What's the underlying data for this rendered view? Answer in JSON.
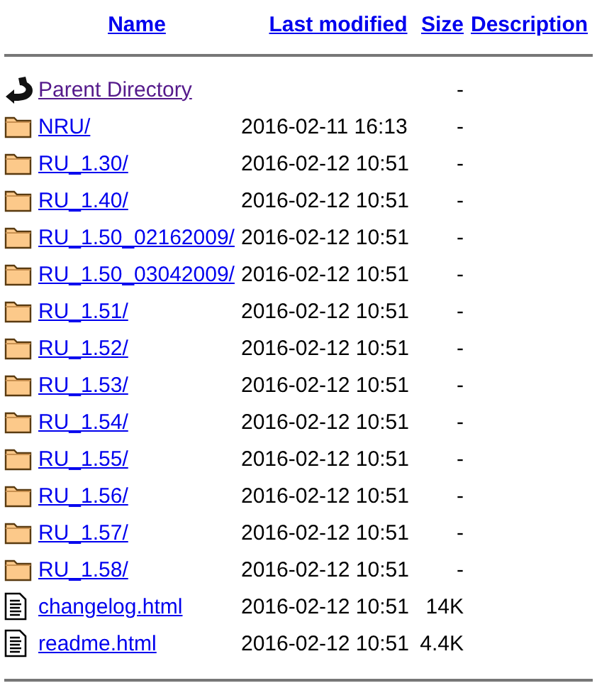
{
  "columns": [
    "Name",
    "Last modified",
    "Size",
    "Description"
  ],
  "entries": [
    {
      "kind": "parent",
      "name": "Parent Directory",
      "visited": true,
      "size": "-"
    },
    {
      "kind": "folder",
      "name": "NRU/",
      "visited": false,
      "modified": "2016-02-11 16:13",
      "size": "-"
    },
    {
      "kind": "folder",
      "name": "RU_1.30/",
      "visited": false,
      "modified": "2016-02-12 10:51",
      "size": "-"
    },
    {
      "kind": "folder",
      "name": "RU_1.40/",
      "visited": false,
      "modified": "2016-02-12 10:51",
      "size": "-"
    },
    {
      "kind": "folder",
      "name": "RU_1.50_02162009/",
      "visited": false,
      "modified": "2016-02-12 10:51",
      "size": "-"
    },
    {
      "kind": "folder",
      "name": "RU_1.50_03042009/",
      "visited": false,
      "modified": "2016-02-12 10:51",
      "size": "-"
    },
    {
      "kind": "folder",
      "name": "RU_1.51/",
      "visited": false,
      "modified": "2016-02-12 10:51",
      "size": "-"
    },
    {
      "kind": "folder",
      "name": "RU_1.52/",
      "visited": false,
      "modified": "2016-02-12 10:51",
      "size": "-"
    },
    {
      "kind": "folder",
      "name": "RU_1.53/",
      "visited": false,
      "modified": "2016-02-12 10:51",
      "size": "-"
    },
    {
      "kind": "folder",
      "name": "RU_1.54/",
      "visited": false,
      "modified": "2016-02-12 10:51",
      "size": "-"
    },
    {
      "kind": "folder",
      "name": "RU_1.55/",
      "visited": false,
      "modified": "2016-02-12 10:51",
      "size": "-"
    },
    {
      "kind": "folder",
      "name": "RU_1.56/",
      "visited": false,
      "modified": "2016-02-12 10:51",
      "size": "-"
    },
    {
      "kind": "folder",
      "name": "RU_1.57/",
      "visited": false,
      "modified": "2016-02-12 10:51",
      "size": "-"
    },
    {
      "kind": "folder",
      "name": "RU_1.58/",
      "visited": false,
      "modified": "2016-02-12 10:51",
      "size": "-"
    },
    {
      "kind": "file",
      "name": "changelog.html",
      "visited": false,
      "modified": "2016-02-12 10:51",
      "size": "14K"
    },
    {
      "kind": "file",
      "name": "readme.html",
      "visited": false,
      "modified": "2016-02-12 10:51",
      "size": "4.4K"
    }
  ]
}
